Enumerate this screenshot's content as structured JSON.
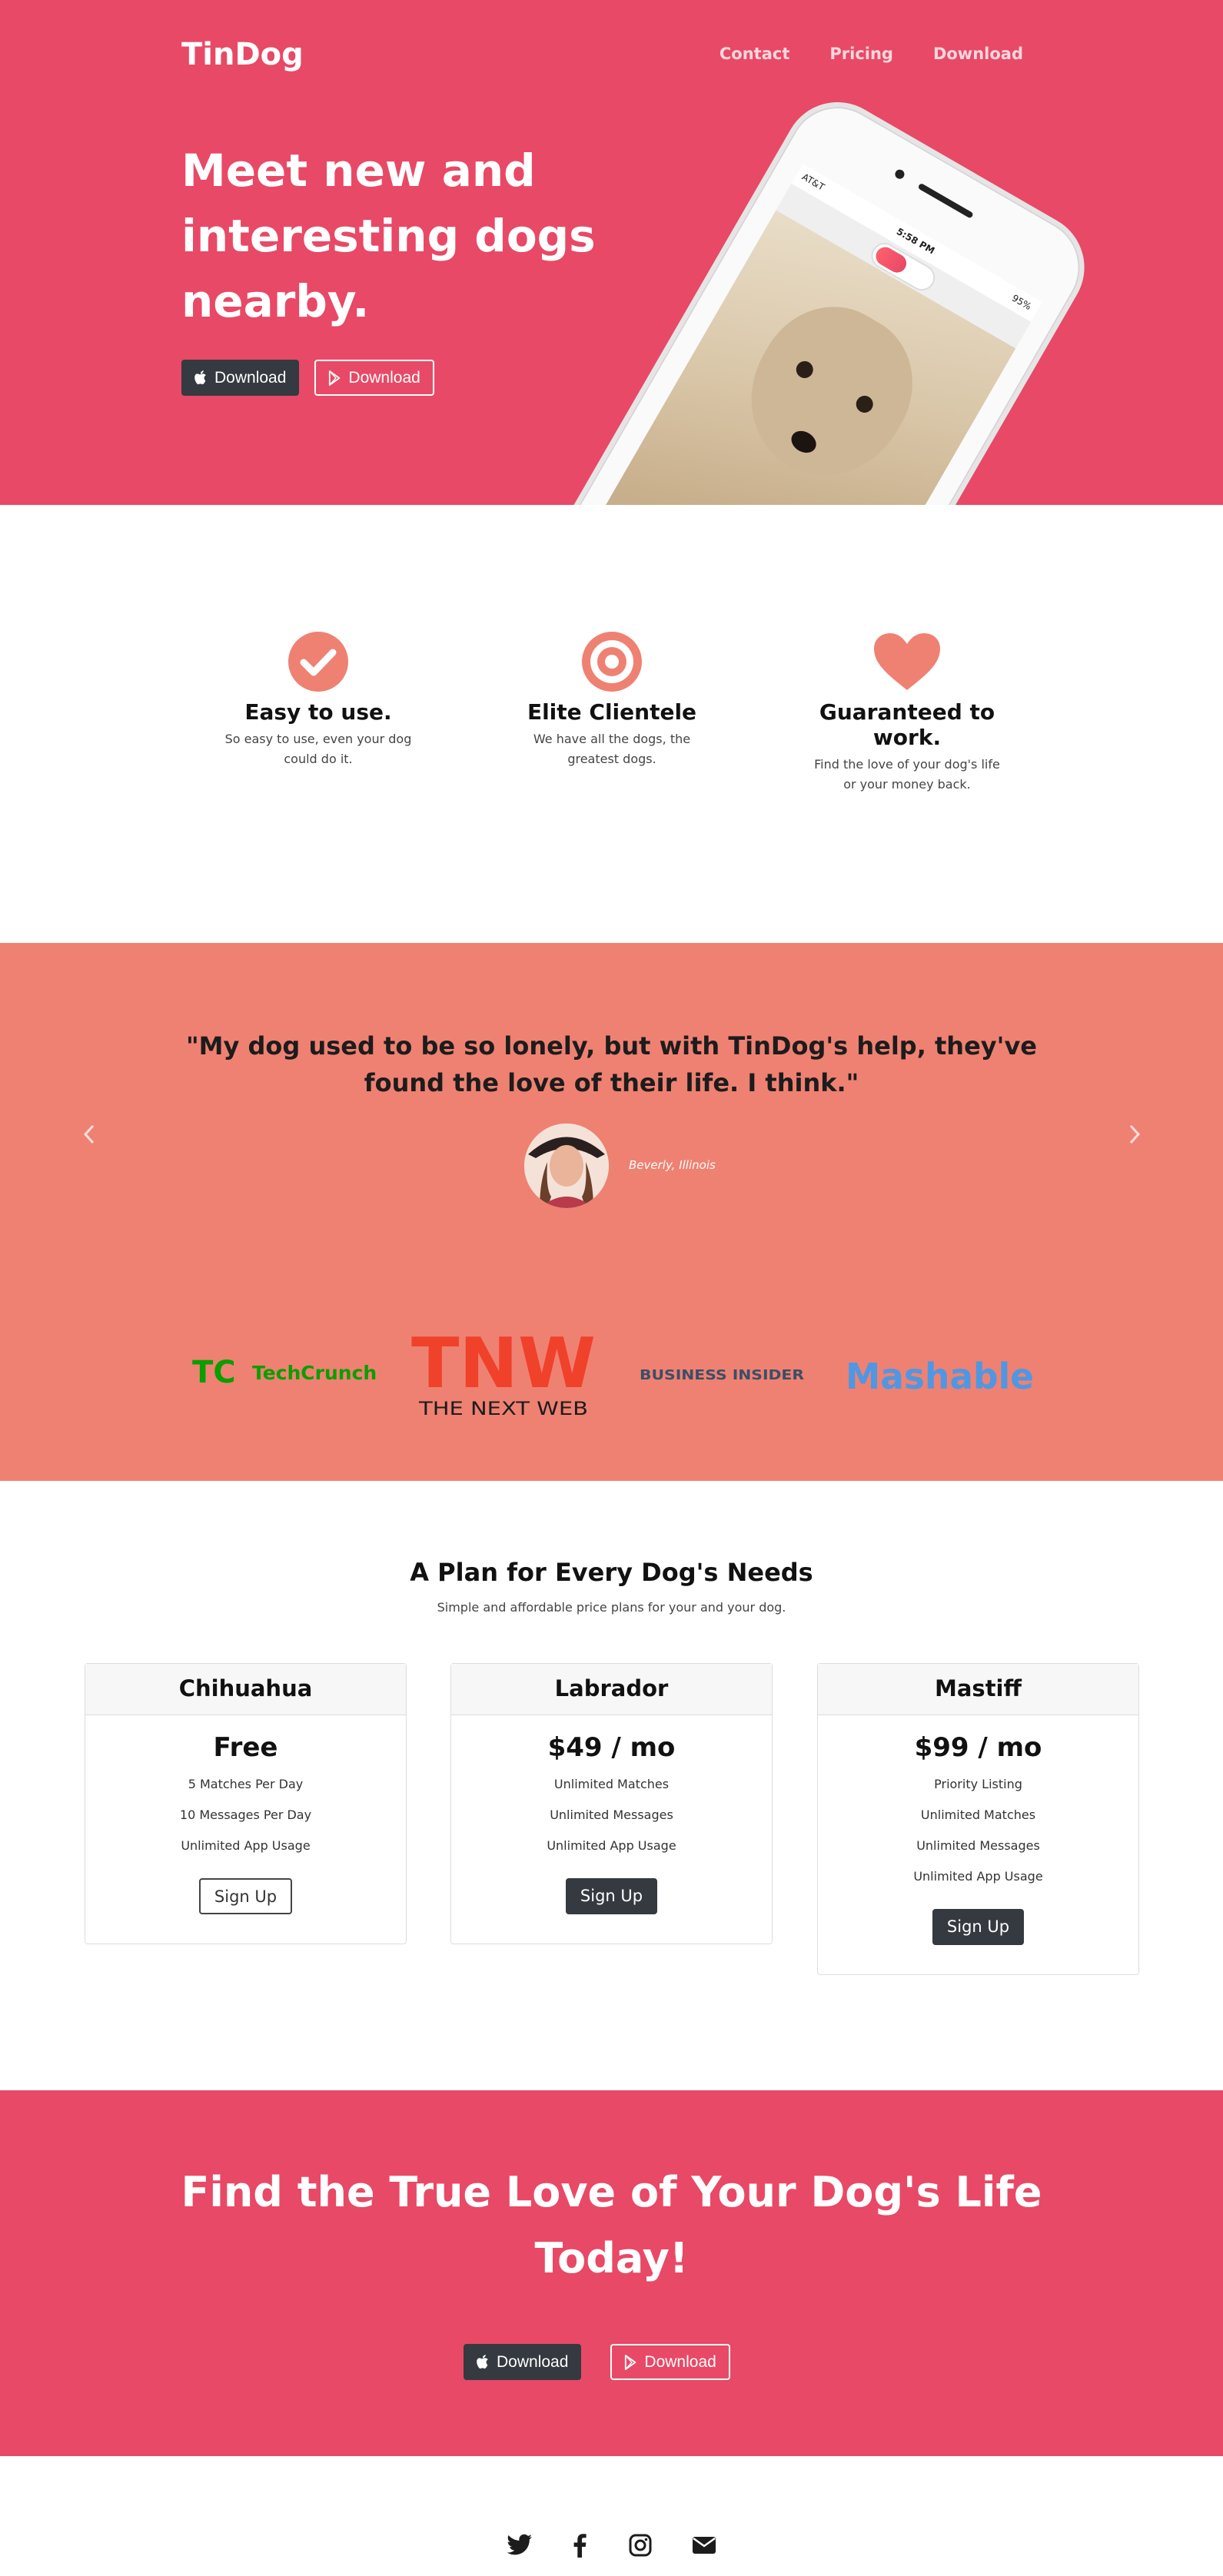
{
  "brand": "TinDog",
  "nav": {
    "contact": "Contact",
    "pricing": "Pricing",
    "download": "Download"
  },
  "hero": {
    "heading": "Meet new and interesting dogs nearby.",
    "apple_download": "Download",
    "google_download": "Download",
    "phone": {
      "carrier": "AT&T",
      "time": "5:58 PM",
      "battery": "95%"
    }
  },
  "features": [
    {
      "icon": "check-circle-icon",
      "title": "Easy to use.",
      "text": "So easy to use, even your dog could do it."
    },
    {
      "icon": "bullseye-icon",
      "title": "Elite Clientele",
      "text": "We have all the dogs, the greatest dogs."
    },
    {
      "icon": "heart-icon",
      "title": "Guaranteed to work.",
      "text": "Find the love of your dog's life or your money back."
    }
  ],
  "testimonial": {
    "quote": "\"My dog used to be so lonely, but with TinDog's help, they've found the love of their life. I think.\"",
    "name": "Beverly, Illinois"
  },
  "press": {
    "techcrunch_tc": "TC",
    "techcrunch": "TechCrunch",
    "tnw": "TNW",
    "tnw_sub": "THE NEXT WEB",
    "business_insider": "BUSINESS INSIDER",
    "mashable": "Mashable"
  },
  "pricing": {
    "title": "A Plan for Every Dog's Needs",
    "subtitle": "Simple and affordable price plans for your and your dog.",
    "plans": [
      {
        "name": "Chihuahua",
        "price": "Free",
        "features": [
          "5 Matches Per Day",
          "10 Messages Per Day",
          "Unlimited App Usage"
        ],
        "cta": "Sign Up"
      },
      {
        "name": "Labrador",
        "price": "$49 / mo",
        "features": [
          "Unlimited Matches",
          "Unlimited Messages",
          "Unlimited App Usage"
        ],
        "cta": "Sign Up"
      },
      {
        "name": "Mastiff",
        "price": "$99 / mo",
        "features": [
          "Priority Listing",
          "Unlimited Matches",
          "Unlimited Messages",
          "Unlimited App Usage"
        ],
        "cta": "Sign Up"
      }
    ]
  },
  "cta": {
    "heading": "Find the True Love of Your Dog's Life Today!",
    "apple_download": "Download",
    "google_download": "Download"
  },
  "footer": {
    "icons": [
      "twitter-icon",
      "facebook-icon",
      "instagram-icon",
      "envelope-icon"
    ]
  },
  "colors": {
    "hero": "#e84966",
    "testimonial": "#ef8172",
    "icon": "#ef8172",
    "dark_button": "#343a40"
  }
}
